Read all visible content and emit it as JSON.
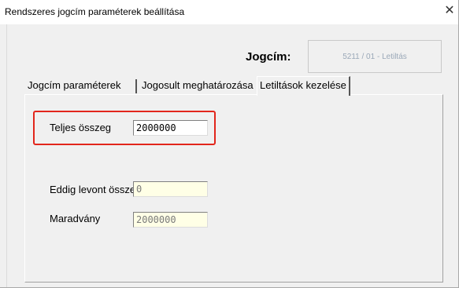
{
  "window": {
    "title": "Rendszeres jogcím paraméterek beállítása",
    "close_glyph": "✕"
  },
  "header": {
    "jogcim_label": "Jogcím:",
    "jogcim_value": "5211 / 01 - Letiltás"
  },
  "tabs": [
    {
      "label": "Jogcím paraméterek",
      "active": false
    },
    {
      "label": "Jogosult meghatározása",
      "active": false
    },
    {
      "label": "Letiltások kezelése",
      "active": true
    }
  ],
  "form": {
    "teljes_label": "Teljes összeg",
    "teljes_value": "2000000",
    "eddig_label": "Eddig levont összeg",
    "eddig_value": "0",
    "maradvany_label": "Maradvány",
    "maradvany_value": "2000000"
  },
  "colors": {
    "highlight": "#e2261c",
    "readonly_bg": "#ffffe6"
  }
}
